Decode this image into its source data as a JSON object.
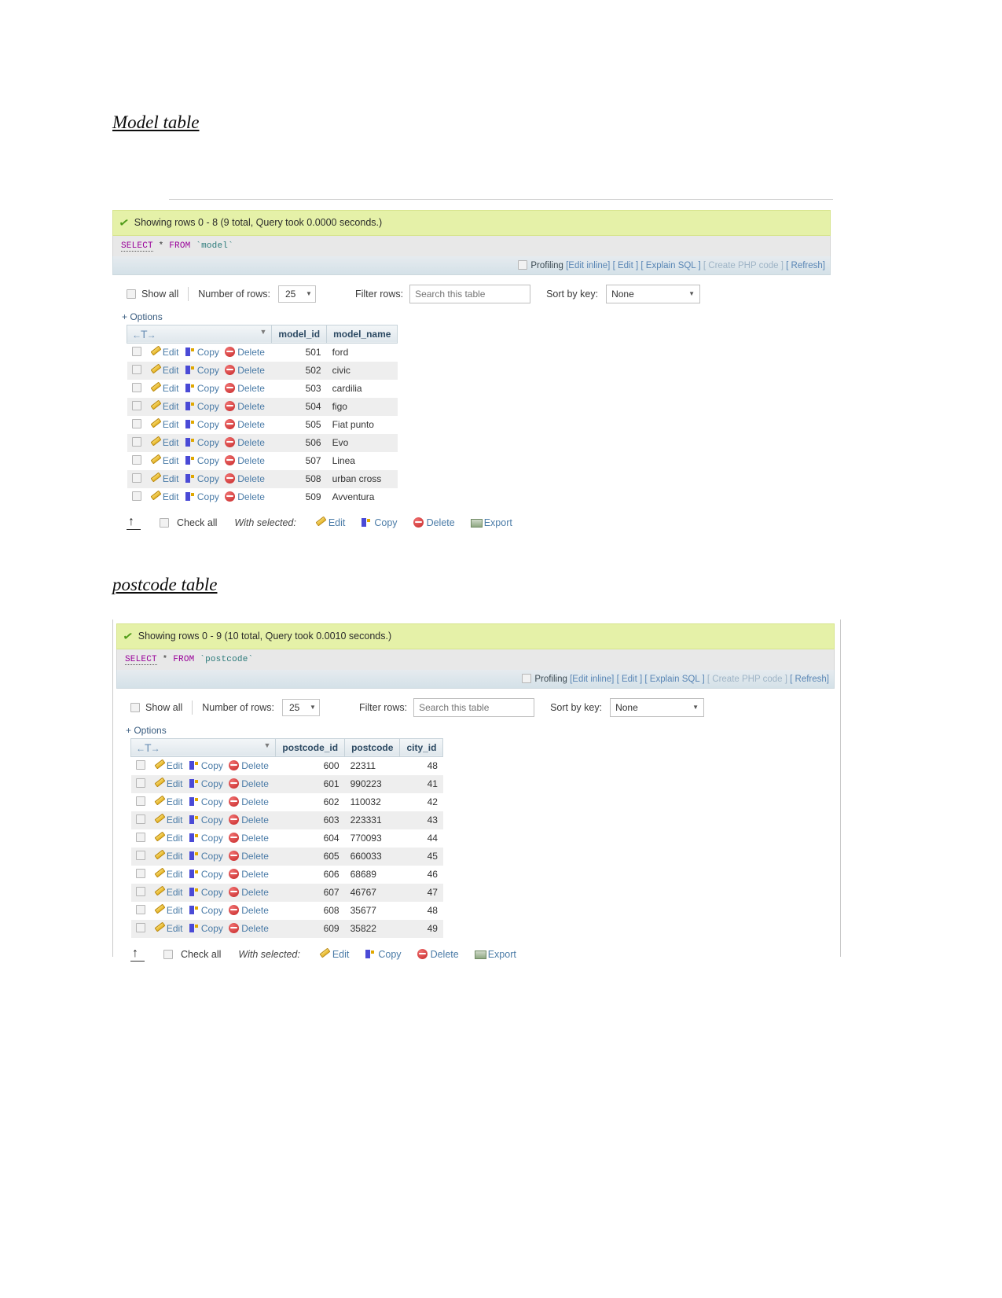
{
  "document": {
    "section1_heading": "Model table",
    "section2_heading": "postcode table"
  },
  "icons": {
    "check": "check-icon",
    "pencil": "pencil-icon",
    "copy": "copy-icon",
    "delete": "delete-circle-icon",
    "export": "export-icon",
    "caret": "▾",
    "sort_left": "←",
    "sort_t": "T",
    "sort_right": "→",
    "up_arrow": "↑"
  },
  "colors": {
    "success_bg": "#e5f1a8",
    "sql_bg": "#e8e8e8",
    "toolbar_bg": "#d4e1e8",
    "link": "#4a7ba7",
    "header_text": "#2d4a63"
  },
  "panel_model": {
    "status": "Showing rows 0 - 8 (9 total, Query took 0.0000 seconds.)",
    "sql": {
      "select": "SELECT",
      "star": "*",
      "from": "FROM",
      "table": "`model`"
    },
    "toolbar": {
      "profiling": "Profiling",
      "links": [
        "[Edit inline]",
        "[ Edit ]",
        "[ Explain SQL ]",
        "[ Create PHP code ]",
        "[ Refresh]"
      ]
    },
    "options": {
      "show_all": "Show all",
      "number_of_rows_label": "Number of rows:",
      "number_of_rows_value": "25",
      "filter_rows_label": "Filter rows:",
      "filter_placeholder": "Search this table",
      "sort_by_key_label": "Sort by key:",
      "sort_by_key_value": "None",
      "options_toggle": "+ Options"
    },
    "actions": {
      "edit": "Edit",
      "copy": "Copy",
      "delete": "Delete"
    },
    "columns": [
      "model_id",
      "model_name"
    ],
    "rows": [
      {
        "model_id": "501",
        "model_name": "ford"
      },
      {
        "model_id": "502",
        "model_name": "civic"
      },
      {
        "model_id": "503",
        "model_name": "cardilia"
      },
      {
        "model_id": "504",
        "model_name": "figo"
      },
      {
        "model_id": "505",
        "model_name": "Fiat punto"
      },
      {
        "model_id": "506",
        "model_name": "Evo"
      },
      {
        "model_id": "507",
        "model_name": "Linea"
      },
      {
        "model_id": "508",
        "model_name": "urban cross"
      },
      {
        "model_id": "509",
        "model_name": "Avventura"
      }
    ],
    "footer": {
      "check_all": "Check all",
      "with_selected": "With selected:",
      "edit": "Edit",
      "copy": "Copy",
      "delete": "Delete",
      "export": "Export"
    }
  },
  "panel_postcode": {
    "status": "Showing rows 0 - 9 (10 total, Query took 0.0010 seconds.)",
    "sql": {
      "select": "SELECT",
      "star": "*",
      "from": "FROM",
      "table": "`postcode`"
    },
    "toolbar": {
      "profiling": "Profiling",
      "links": [
        "[Edit inline]",
        "[ Edit ]",
        "[ Explain SQL ]",
        "[ Create PHP code ]",
        "[ Refresh]"
      ]
    },
    "options": {
      "show_all": "Show all",
      "number_of_rows_label": "Number of rows:",
      "number_of_rows_value": "25",
      "filter_rows_label": "Filter rows:",
      "filter_placeholder": "Search this table",
      "sort_by_key_label": "Sort by key:",
      "sort_by_key_value": "None",
      "options_toggle": "+ Options"
    },
    "actions": {
      "edit": "Edit",
      "copy": "Copy",
      "delete": "Delete"
    },
    "columns": [
      "postcode_id",
      "postcode",
      "city_id"
    ],
    "rows": [
      {
        "postcode_id": "600",
        "postcode": "22311",
        "city_id": "48"
      },
      {
        "postcode_id": "601",
        "postcode": "990223",
        "city_id": "41"
      },
      {
        "postcode_id": "602",
        "postcode": "110032",
        "city_id": "42"
      },
      {
        "postcode_id": "603",
        "postcode": "223331",
        "city_id": "43"
      },
      {
        "postcode_id": "604",
        "postcode": "770093",
        "city_id": "44"
      },
      {
        "postcode_id": "605",
        "postcode": "660033",
        "city_id": "45"
      },
      {
        "postcode_id": "606",
        "postcode": "68689",
        "city_id": "46"
      },
      {
        "postcode_id": "607",
        "postcode": "46767",
        "city_id": "47"
      },
      {
        "postcode_id": "608",
        "postcode": "35677",
        "city_id": "48"
      },
      {
        "postcode_id": "609",
        "postcode": "35822",
        "city_id": "49"
      }
    ],
    "footer": {
      "check_all": "Check all",
      "with_selected": "With selected:",
      "edit": "Edit",
      "copy": "Copy",
      "delete": "Delete",
      "export": "Export"
    }
  }
}
